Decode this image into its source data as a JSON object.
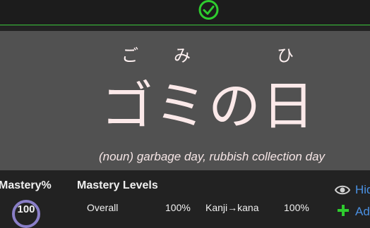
{
  "card": {
    "furigana": [
      "ご",
      "み",
      "ひ"
    ],
    "word": "ゴミの日",
    "meaning_pos": "(noun)",
    "meaning_text": "garbage day, rubbish collection day"
  },
  "stats": {
    "mastery_percent_title": "Mastery%",
    "mastery_value": "100",
    "mastery_levels_title": "Mastery Levels",
    "rows": [
      {
        "label": "Overall",
        "value": "100%",
        "label2": "Kanji→kana",
        "value2": "100%"
      }
    ]
  },
  "side": {
    "hide_label": "Hid",
    "add_label": "Ad"
  },
  "colors": {
    "check": "#2ecc2e",
    "accent_line": "#3cc83c",
    "mastery_ring": "#8a7fc8",
    "link": "#4a90e2"
  },
  "icons": {
    "check": "check-circle-icon",
    "eye": "eye-icon",
    "plus": "plus-icon"
  }
}
